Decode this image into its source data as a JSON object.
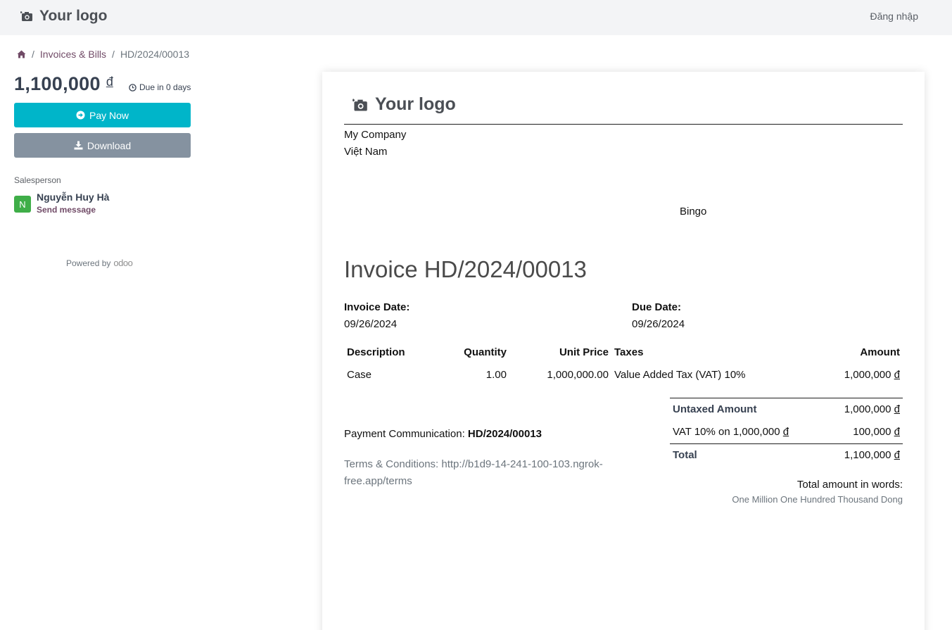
{
  "navbar": {
    "logo_text": "Your logo",
    "login_label": "Đăng nhập"
  },
  "sidebar": {
    "breadcrumb": {
      "section": "Invoices & Bills",
      "current": "HD/2024/00013"
    },
    "amount": "1,100,000",
    "currency": "đ",
    "due_text": "Due in 0 days",
    "pay_now_label": "Pay Now",
    "download_label": "Download",
    "salesperson_label": "Salesperson",
    "salesperson": {
      "initial": "N",
      "name": "Nguyễn Huy Hà",
      "send_message": "Send message"
    },
    "powered_by": "Powered by",
    "powered_brand": "odoo"
  },
  "invoice": {
    "logo_text": "Your logo",
    "company_name": "My Company",
    "company_country": "Việt Nam",
    "partner": "Bingo",
    "title": "Invoice HD/2024/00013",
    "invoice_date_label": "Invoice Date:",
    "invoice_date": "09/26/2024",
    "due_date_label": "Due Date:",
    "due_date": "09/26/2024",
    "columns": [
      "Description",
      "Quantity",
      "Unit Price",
      "Taxes",
      "Amount"
    ],
    "lines": [
      {
        "description": "Case",
        "quantity": "1.00",
        "unit_price": "1,000,000.00",
        "taxes": "Value Added Tax (VAT) 10%",
        "amount": "1,000,000",
        "currency": "đ"
      }
    ],
    "totals": {
      "untaxed_label": "Untaxed Amount",
      "untaxed_value": "1,000,000",
      "vat_label": "VAT 10% on 1,000,000",
      "vat_value": "100,000",
      "total_label": "Total",
      "total_value": "1,100,000",
      "currency": "đ"
    },
    "payment_comm_label": "Payment Communication:",
    "payment_comm_value": "HD/2024/00013",
    "terms_line1": "Terms & Conditions: http://b1d9-14-241-100-103.ngrok-",
    "terms_line2": "free.app/terms",
    "words_label": "Total amount in words:",
    "words_value": "One Million One Hundred Thousand Dong"
  },
  "colors": {
    "brand": "#714b67",
    "pay_button": "#00b5c9",
    "download_button": "#8592a0",
    "avatar": "#3fae48"
  }
}
